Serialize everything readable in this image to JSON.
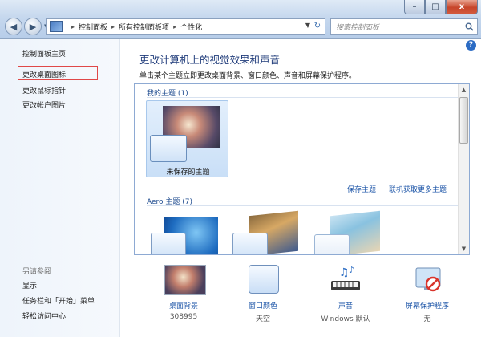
{
  "window": {
    "buttons": {
      "minimize": "–",
      "maximize": "□",
      "close": "x"
    }
  },
  "nav": {
    "back_icon": "arrow-left-icon",
    "forward_icon": "arrow-right-icon"
  },
  "breadcrumb": {
    "items": [
      "控制面板",
      "所有控制面板项",
      "个性化"
    ]
  },
  "search": {
    "placeholder": "搜索控制面板"
  },
  "sidebar": {
    "items": [
      {
        "label": "控制面板主页"
      },
      {
        "label": "更改桌面图标"
      },
      {
        "label": "更改鼠标指针"
      },
      {
        "label": "更改帐户图片"
      }
    ],
    "see_also": "另请参阅",
    "see_also_items": [
      {
        "label": "显示"
      },
      {
        "label": "任务栏和「开始」菜单"
      },
      {
        "label": "轻松访问中心"
      }
    ]
  },
  "main": {
    "title": "更改计算机上的视觉效果和声音",
    "subtitle": "单击某个主题立即更改桌面背景、窗口颜色、声音和屏幕保护程序。",
    "my_themes_label": "我的主题 (1)",
    "unsaved_theme": "未保存的主题",
    "save_theme": "保存主题",
    "get_more_themes": "联机获取更多主题",
    "aero_label": "Aero 主题 (7)"
  },
  "bottom": {
    "items": [
      {
        "label": "桌面背景",
        "value": "308995"
      },
      {
        "label": "窗口颜色",
        "value": "天空"
      },
      {
        "label": "声音",
        "value": "Windows 默认"
      },
      {
        "label": "屏幕保护程序",
        "value": "无"
      }
    ]
  },
  "colors": {
    "accent_link": "#1e56a8",
    "title_blue": "#1f3b7a",
    "highlight_box": "#e04848"
  }
}
